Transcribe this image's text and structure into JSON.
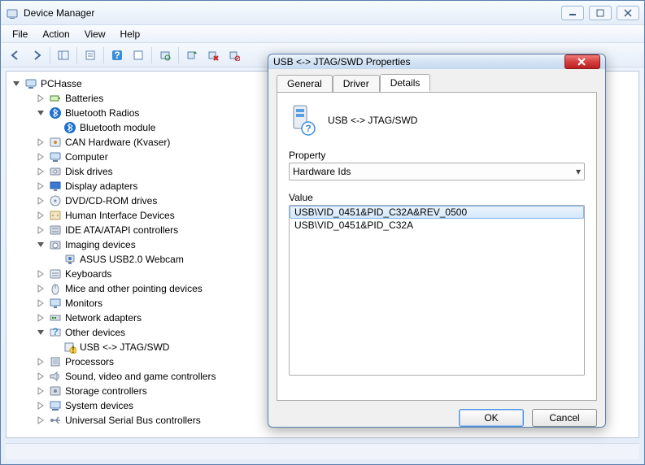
{
  "window": {
    "title": "Device Manager"
  },
  "menubar": [
    "File",
    "Action",
    "View",
    "Help"
  ],
  "tree": {
    "root": "PCHasse",
    "nodes": [
      {
        "label": "Batteries",
        "icon": "battery",
        "depth": 1,
        "expander": "closed"
      },
      {
        "label": "Bluetooth Radios",
        "icon": "bluetooth",
        "depth": 1,
        "expander": "open"
      },
      {
        "label": "Bluetooth module",
        "icon": "bluetooth",
        "depth": 2,
        "expander": "none"
      },
      {
        "label": "CAN Hardware (Kvaser)",
        "icon": "can",
        "depth": 1,
        "expander": "closed"
      },
      {
        "label": "Computer",
        "icon": "computer",
        "depth": 1,
        "expander": "closed"
      },
      {
        "label": "Disk drives",
        "icon": "disk",
        "depth": 1,
        "expander": "closed"
      },
      {
        "label": "Display adapters",
        "icon": "display",
        "depth": 1,
        "expander": "closed"
      },
      {
        "label": "DVD/CD-ROM drives",
        "icon": "optical",
        "depth": 1,
        "expander": "closed"
      },
      {
        "label": "Human Interface Devices",
        "icon": "hid",
        "depth": 1,
        "expander": "closed"
      },
      {
        "label": "IDE ATA/ATAPI controllers",
        "icon": "ide",
        "depth": 1,
        "expander": "closed"
      },
      {
        "label": "Imaging devices",
        "icon": "imaging",
        "depth": 1,
        "expander": "open"
      },
      {
        "label": "ASUS USB2.0 Webcam",
        "icon": "webcam",
        "depth": 2,
        "expander": "none"
      },
      {
        "label": "Keyboards",
        "icon": "keyboard",
        "depth": 1,
        "expander": "closed"
      },
      {
        "label": "Mice and other pointing devices",
        "icon": "mouse",
        "depth": 1,
        "expander": "closed"
      },
      {
        "label": "Monitors",
        "icon": "monitor",
        "depth": 1,
        "expander": "closed"
      },
      {
        "label": "Network adapters",
        "icon": "network",
        "depth": 1,
        "expander": "closed"
      },
      {
        "label": "Other devices",
        "icon": "other",
        "depth": 1,
        "expander": "open"
      },
      {
        "label": "USB <-> JTAG/SWD",
        "icon": "unknown",
        "depth": 2,
        "expander": "none"
      },
      {
        "label": "Processors",
        "icon": "cpu",
        "depth": 1,
        "expander": "closed"
      },
      {
        "label": "Sound, video and game controllers",
        "icon": "sound",
        "depth": 1,
        "expander": "closed"
      },
      {
        "label": "Storage controllers",
        "icon": "storage",
        "depth": 1,
        "expander": "closed"
      },
      {
        "label": "System devices",
        "icon": "system",
        "depth": 1,
        "expander": "closed"
      },
      {
        "label": "Universal Serial Bus controllers",
        "icon": "usb",
        "depth": 1,
        "expander": "closed"
      }
    ]
  },
  "dialog": {
    "title": "USB <-> JTAG/SWD Properties",
    "tabs": [
      "General",
      "Driver",
      "Details"
    ],
    "active_tab": 2,
    "device_name": "USB <-> JTAG/SWD",
    "property_label": "Property",
    "value_label": "Value",
    "property_selected": "Hardware Ids",
    "values": [
      "USB\\VID_0451&PID_C32A&REV_0500",
      "USB\\VID_0451&PID_C32A"
    ],
    "selected_value_index": 0,
    "ok": "OK",
    "cancel": "Cancel"
  }
}
